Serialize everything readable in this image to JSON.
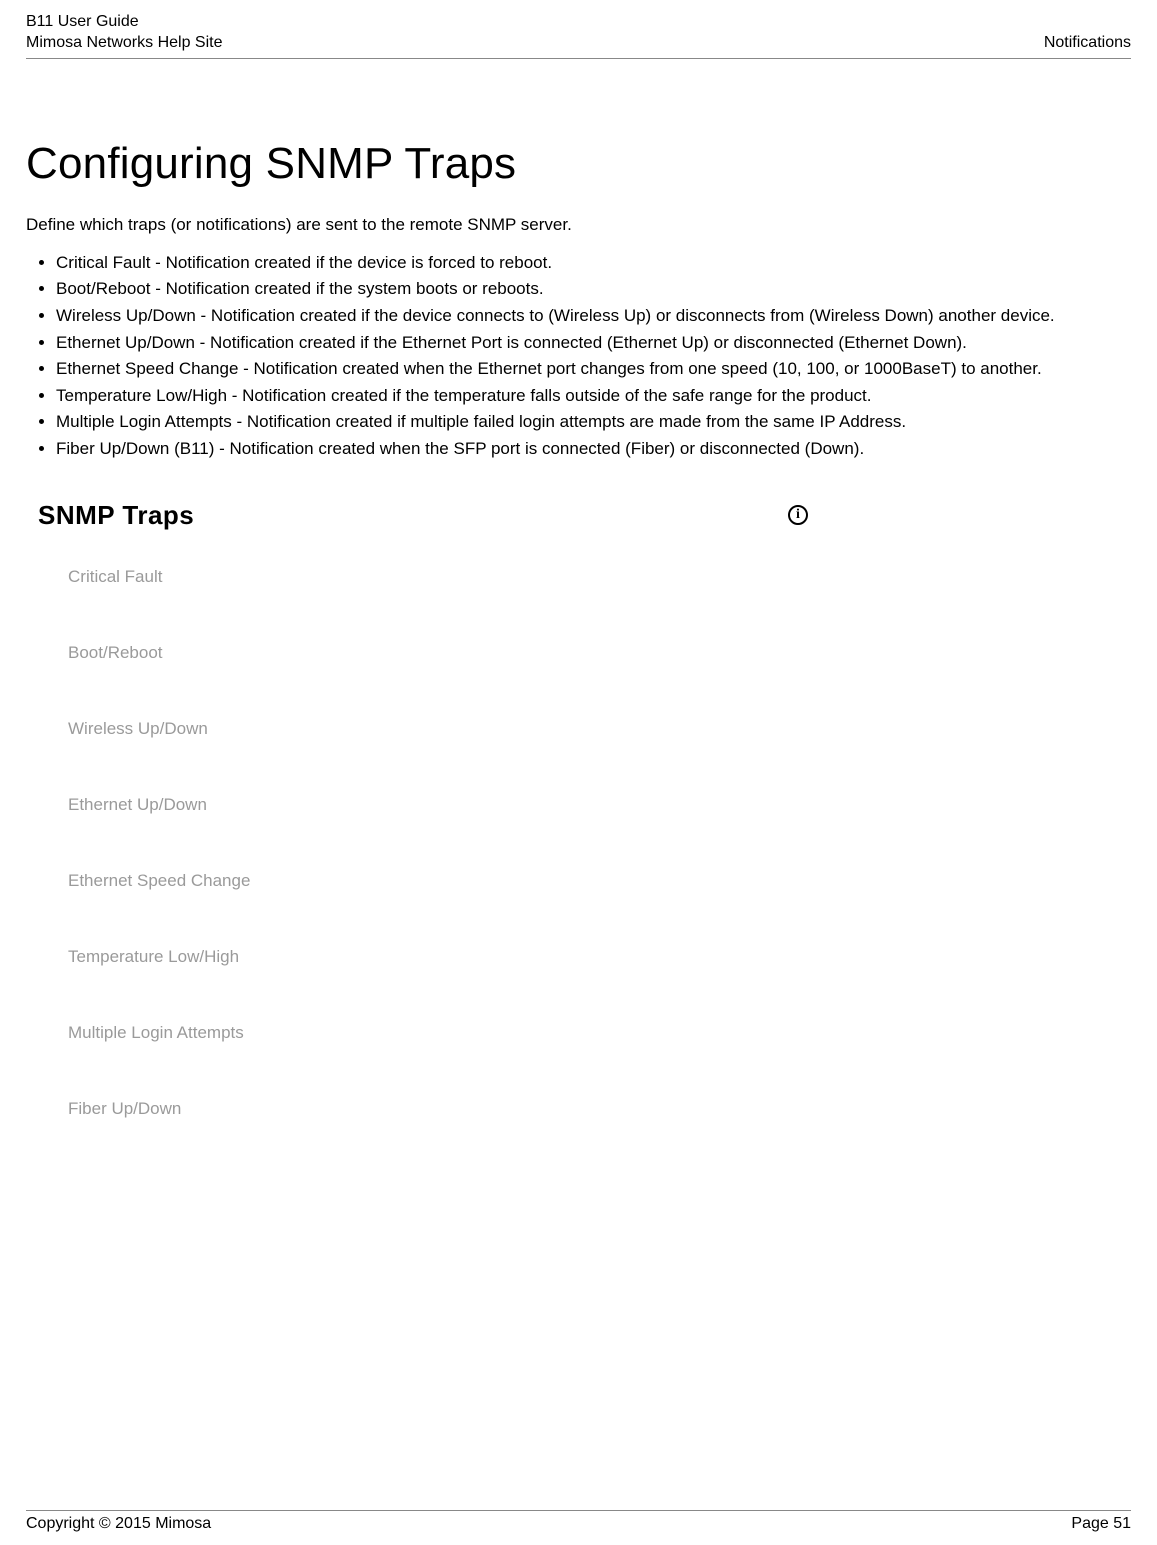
{
  "header": {
    "title_line1": "B11 User Guide",
    "title_line2": "Mimosa Networks Help Site",
    "right": "Notifications"
  },
  "main": {
    "heading": "Configuring SNMP Traps",
    "intro": "Define which traps (or notifications) are sent to the remote SNMP server.",
    "bullets": [
      "Critical Fault - Notification created if the device is forced to reboot.",
      "Boot/Reboot  - Notification created if the system boots or reboots.",
      "Wireless Up/Down  - Notification created if the device connects to (Wireless Up) or disconnects from (Wireless Down) another device.",
      "Ethernet Up/Down - Notification created if the Ethernet Port is connected (Ethernet Up) or disconnected (Ethernet Down).",
      "Ethernet Speed Change - Notification created when the Ethernet port changes from one speed (10, 100, or 1000BaseT) to another.",
      "Temperature Low/High - Notification created if the temperature falls outside of the safe range for the product.",
      "Multiple Login Attempts - Notification created if multiple failed login attempts are made from the same IP Address.",
      "Fiber Up/Down (B11) - Notification created when the SFP port is connected (Fiber) or disconnected (Down)."
    ]
  },
  "panel": {
    "title": "SNMP Traps",
    "info_glyph": "i",
    "options": [
      "Critical Fault",
      "Boot/Reboot",
      "Wireless Up/Down",
      "Ethernet Up/Down",
      "Ethernet Speed Change",
      "Temperature Low/High",
      "Multiple Login Attempts",
      "Fiber Up/Down"
    ]
  },
  "footer": {
    "copyright": "Copyright © 2015 Mimosa",
    "page": "Page 51"
  }
}
